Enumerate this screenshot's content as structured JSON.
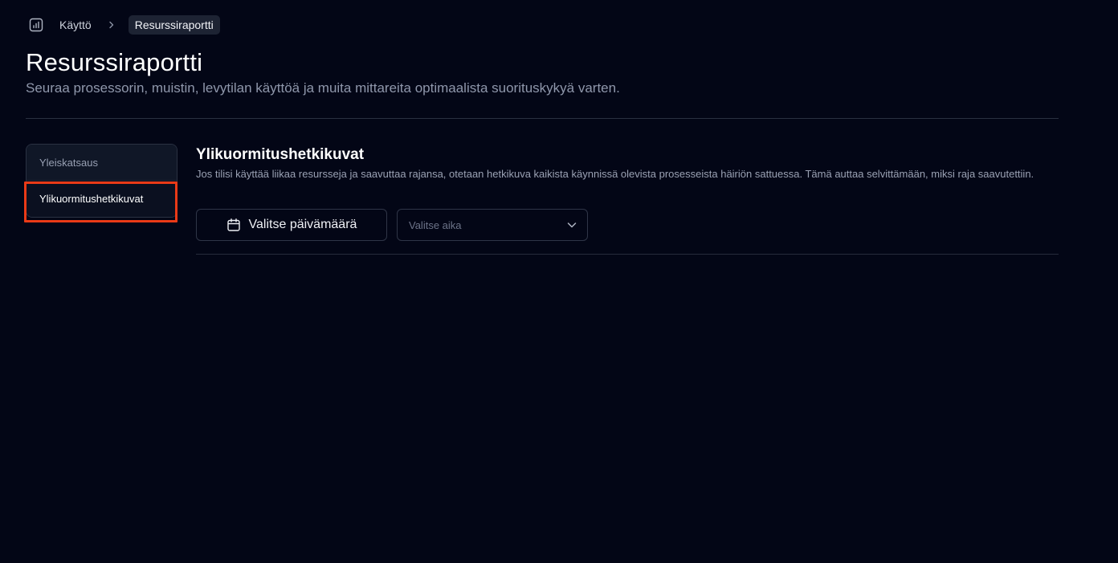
{
  "breadcrumb": {
    "icon": "bar-chart-icon",
    "parent": "Käyttö",
    "separator_icon": "chevron-right-icon",
    "current": "Resurssiraportti"
  },
  "header": {
    "title": "Resurssiraportti",
    "subtitle": "Seuraa prosessorin, muistin, levytilan käyttöä ja muita mittareita optimaalista suorituskykyä varten."
  },
  "sidebar": {
    "items": [
      {
        "label": "Yleiskatsaus",
        "active": false
      },
      {
        "label": "Ylikuormitushetkikuvat",
        "active": true
      }
    ]
  },
  "main": {
    "title": "Ylikuormitushetkikuvat",
    "description": "Jos tilisi käyttää liikaa resursseja ja saavuttaa rajansa, otetaan hetkikuva kaikista käynnissä olevista prosesseista häiriön sattuessa. Tämä auttaa selvittämään, miksi raja saavutettiin.",
    "date_button": {
      "label": "Valitse päivämäärä",
      "icon": "calendar-icon"
    },
    "time_select": {
      "placeholder": "Valitse aika",
      "icon": "chevron-down-icon"
    }
  },
  "colors": {
    "background": "#030616",
    "highlight": "#ea3a17",
    "active_text": "#ffffff",
    "muted_text": "#8f97ab"
  }
}
